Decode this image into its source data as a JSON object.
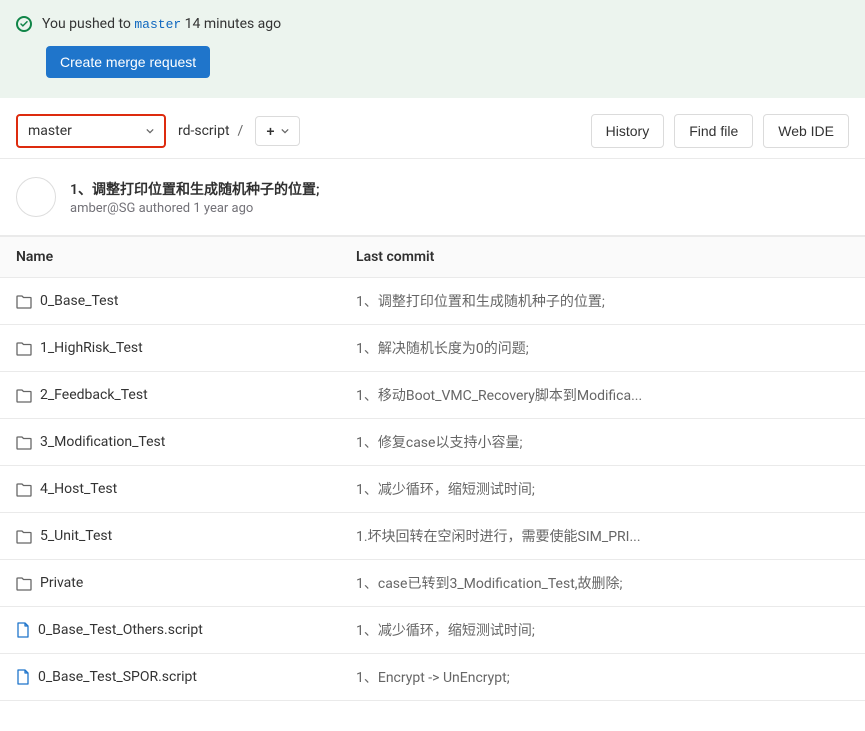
{
  "alert": {
    "text_prefix": "You pushed to ",
    "branch": "master",
    "text_suffix": " 14 minutes ago",
    "button_label": "Create merge request"
  },
  "nav": {
    "branch_selector": "master",
    "breadcrumb": "rd-script",
    "breadcrumb_sep": "/",
    "buttons": {
      "history": "History",
      "find_file": "Find file",
      "web_ide": "Web IDE"
    }
  },
  "latest_commit": {
    "message": "1、调整打印位置和生成随机种子的位置;",
    "author": "amber@SG",
    "meta_text": "authored 1 year ago"
  },
  "table": {
    "col_name": "Name",
    "col_commit": "Last commit"
  },
  "files": [
    {
      "type": "folder",
      "name": "0_Base_Test",
      "commit": "1、调整打印位置和生成随机种子的位置;"
    },
    {
      "type": "folder",
      "name": "1_HighRisk_Test",
      "commit": "1、解决随机长度为0的问题;"
    },
    {
      "type": "folder",
      "name": "2_Feedback_Test",
      "commit": "1、移动Boot_VMC_Recovery脚本到Modifica..."
    },
    {
      "type": "folder",
      "name": "3_Modification_Test",
      "commit": "1、修复case以支持小容量;"
    },
    {
      "type": "folder",
      "name": "4_Host_Test",
      "commit": "1、减少循环，缩短测试时间;"
    },
    {
      "type": "folder",
      "name": "5_Unit_Test",
      "commit": "1.坏块回转在空闲时进行，需要使能SIM_PRI..."
    },
    {
      "type": "folder",
      "name": "Private",
      "commit": "1、case已转到3_Modification_Test,故删除;"
    },
    {
      "type": "file",
      "name": "0_Base_Test_Others.script",
      "commit": "1、减少循环，缩短测试时间;"
    },
    {
      "type": "file",
      "name": "0_Base_Test_SPOR.script",
      "commit": "1、Encrypt -> UnEncrypt;"
    }
  ]
}
